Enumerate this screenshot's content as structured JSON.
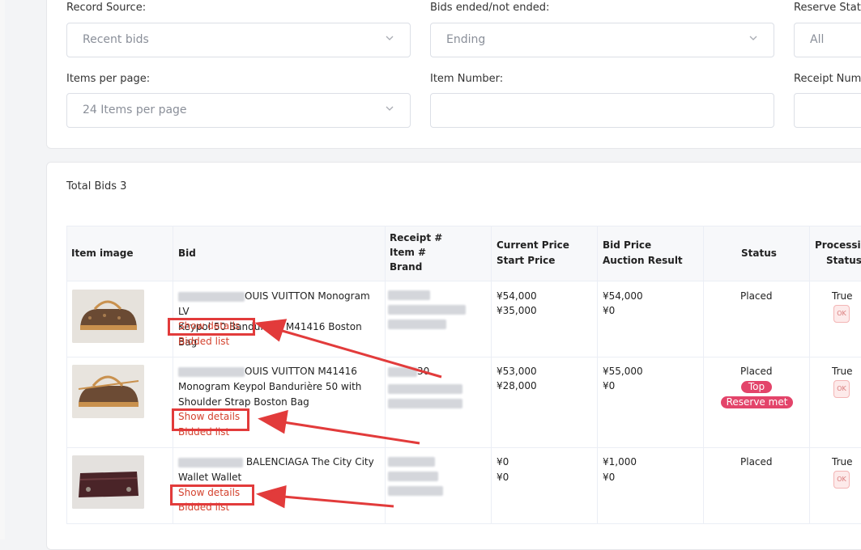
{
  "filters": {
    "record_source": {
      "label": "Record Source:",
      "value": "Recent bids"
    },
    "bids_ended": {
      "label": "Bids ended/not ended:",
      "value": "Ending"
    },
    "reserve_status": {
      "label": "Reserve Statu",
      "value": "All"
    },
    "items_per_page": {
      "label": "Items per page:",
      "value": "24 Items per page"
    },
    "item_number": {
      "label": "Item Number:",
      "value": ""
    },
    "receipt_number": {
      "label": "Receipt Num",
      "value": ""
    }
  },
  "results": {
    "total": "Total Bids 3",
    "columns": {
      "item_image": "Item image",
      "bid": "Bid",
      "receipt": "Receipt #",
      "item_no": "Item #",
      "brand": "Brand",
      "current_price": "Current Price",
      "start_price": "Start Price",
      "bid_price": "Bid Price",
      "auction_result": "Auction Result",
      "status": "Status",
      "processing": "Processin",
      "processing2": "Status"
    },
    "rows": [
      {
        "title_line1": "OUIS VUITTON Monogram LV",
        "title_line2": "Keypol 50 Bandurière M41416 Boston Bag",
        "title_line3": "",
        "current_price": "¥54,000",
        "start_price": "¥35,000",
        "bid_price": "¥54,000",
        "auction_result": "¥0",
        "status": "Placed",
        "processing": "True"
      },
      {
        "title_line1": "OUIS VUITTON M41416",
        "title_line2": "Monogram Keypol Bandurière 50 with",
        "title_line3": "Shoulder Strap Boston Bag",
        "receipt_partial": "30",
        "current_price": "¥53,000",
        "start_price": "¥28,000",
        "bid_price": "¥55,000",
        "auction_result": "¥0",
        "status": "Placed",
        "badge_top": "Top",
        "badge_reserve": "Reserve met",
        "processing": "True"
      },
      {
        "title_line1": "BALENCIAGA The City City",
        "title_line2": "Wallet Wallet",
        "title_line3": "",
        "current_price": "¥0",
        "start_price": "¥0",
        "bid_price": "¥1,000",
        "auction_result": "¥0",
        "status": "Placed",
        "processing": "True"
      }
    ],
    "show_details_label": "Show details",
    "bidded_list_label": "Bidded list",
    "ok_label": "OK"
  },
  "colors": {
    "link": "#d4422e",
    "annotation": "#e23b3b",
    "badge": "#e3446a"
  }
}
